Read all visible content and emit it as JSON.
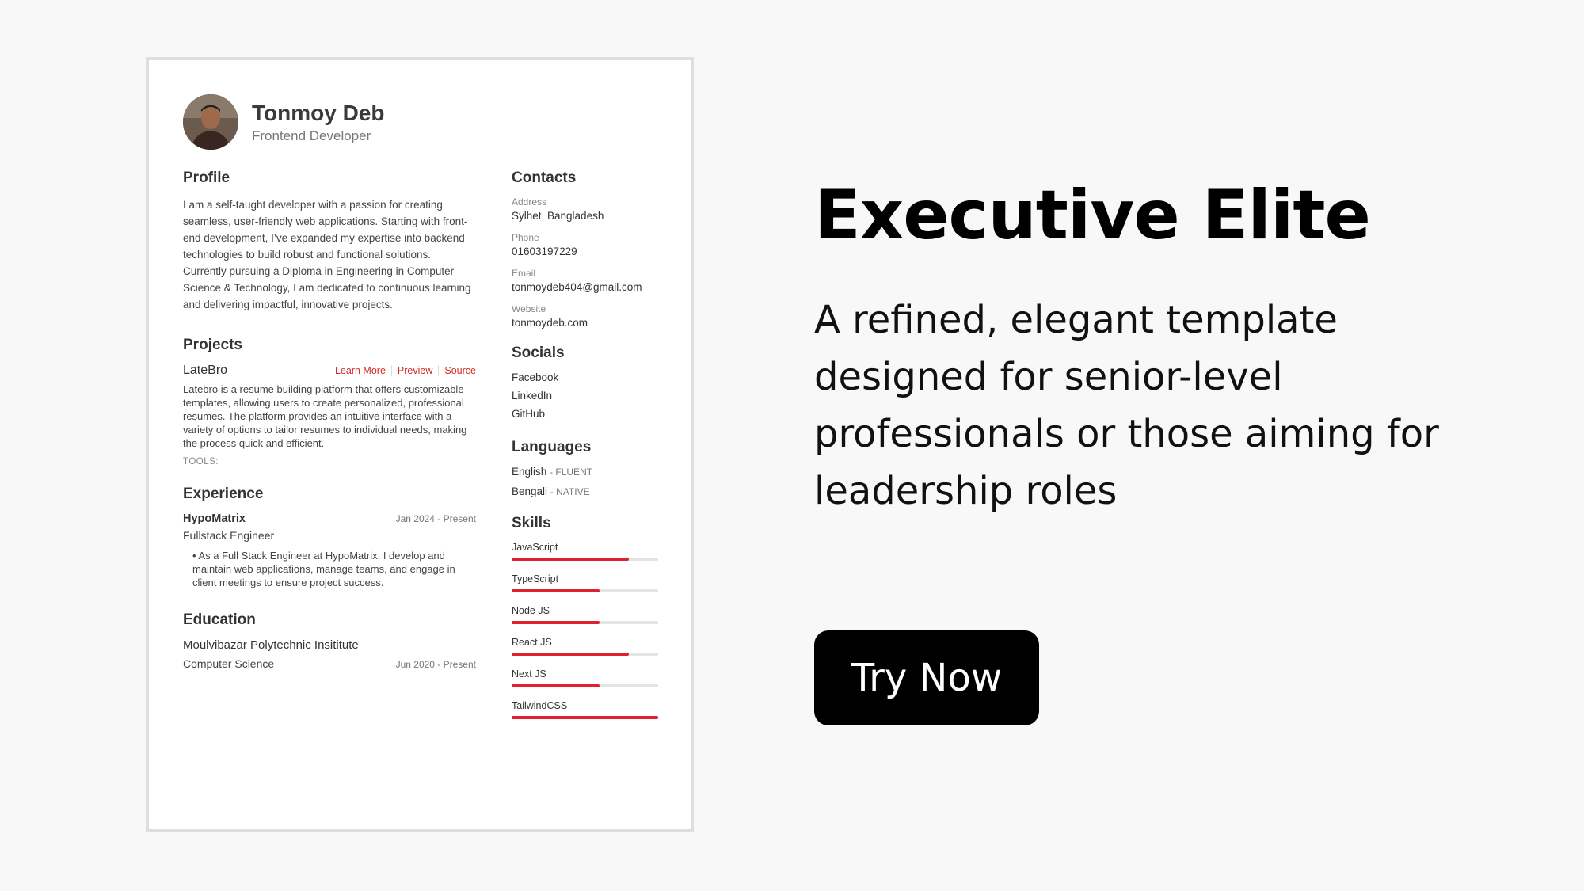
{
  "resume": {
    "name": "Tonmoy Deb",
    "role": "Frontend Developer",
    "profile": {
      "title": "Profile",
      "text": "I am a self-taught developer with a passion for creating seamless, user-friendly web applications. Starting with front-end development, I’ve expanded my expertise into backend technologies to build robust and functional solutions. Currently pursuing a Diploma in Engineering in Computer Science & Technology, I am dedicated to continuous learning and delivering impactful, innovative projects."
    },
    "projects": {
      "title": "Projects",
      "items": [
        {
          "name": "LateBro",
          "links": [
            "Learn More",
            "Preview",
            "Source"
          ],
          "description": "Latebro is a resume building platform that offers customizable templates, allowing users to create personalized, professional resumes. The platform provides an intuitive interface with a variety of options to tailor resumes to individual needs, making the process quick and efficient.",
          "tools_label": "TOOLS:"
        }
      ]
    },
    "experience": {
      "title": "Experience",
      "items": [
        {
          "company": "HypoMatrix",
          "date": "Jan 2024 - Present",
          "position": "Fullstack Engineer",
          "bullets": [
            "As a Full Stack Engineer at HypoMatrix, I develop and maintain web applications, manage teams, and engage in client meetings to ensure project success."
          ]
        }
      ]
    },
    "education": {
      "title": "Education",
      "items": [
        {
          "school": "Moulvibazar Polytechnic Insititute",
          "degree": "Computer Science",
          "date": "Jun 2020 - Present"
        }
      ]
    },
    "contacts": {
      "title": "Contacts",
      "items": [
        {
          "label": "Address",
          "value": "Sylhet, Bangladesh"
        },
        {
          "label": "Phone",
          "value": "01603197229"
        },
        {
          "label": "Email",
          "value": "tonmoydeb404@gmail.com"
        },
        {
          "label": "Website",
          "value": "tonmoydeb.com"
        }
      ]
    },
    "socials": {
      "title": "Socials",
      "items": [
        "Facebook",
        "LinkedIn",
        "GitHub"
      ]
    },
    "languages": {
      "title": "Languages",
      "items": [
        {
          "name": "English",
          "level": "FLUENT"
        },
        {
          "name": "Bengali",
          "level": "NATIVE"
        }
      ]
    },
    "skills": {
      "title": "Skills",
      "items": [
        {
          "name": "JavaScript",
          "level": 0.8
        },
        {
          "name": "TypeScript",
          "level": 0.6
        },
        {
          "name": "Node JS",
          "level": 0.6
        },
        {
          "name": "React JS",
          "level": 0.8
        },
        {
          "name": "Next JS",
          "level": 0.6
        },
        {
          "name": "TailwindCSS",
          "level": 1.0
        }
      ]
    }
  },
  "hero": {
    "title": "Executive Elite",
    "subtitle": "A refined, elegant template designed for senior-level professionals or those aiming for leadership roles",
    "cta_label": "Try Now"
  },
  "colors": {
    "accent": "#e0202e",
    "link": "#d42a2a",
    "cta_bg": "#000000",
    "page_bg": "#f8f8f8"
  }
}
